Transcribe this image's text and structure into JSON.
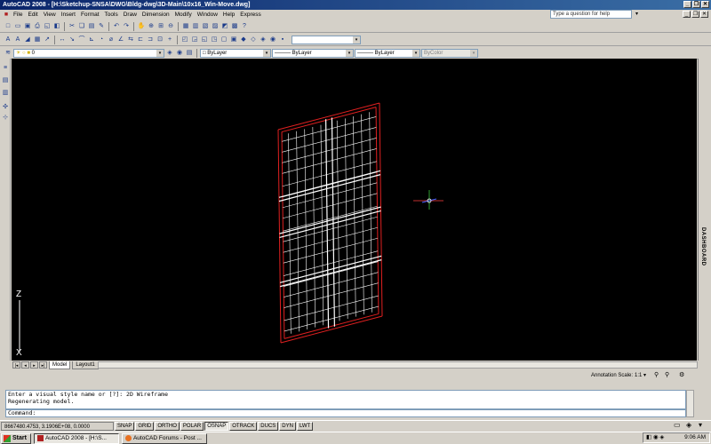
{
  "window": {
    "title": "AutoCAD 2008 - [H:\\Sketchup-SNSA\\DWG\\Bldg-dwg\\3D-Main\\10x16_Win-Move.dwg]",
    "buttons": [
      "_",
      "❐",
      "✕"
    ]
  },
  "menu": [
    "File",
    "Edit",
    "View",
    "Insert",
    "Format",
    "Tools",
    "Draw",
    "Dimension",
    "Modify",
    "Window",
    "Help",
    "Express"
  ],
  "help_search": {
    "placeholder": "Type a question for help"
  },
  "layers": {
    "current_layer": "0",
    "color": "ByLayer",
    "linetype": "ByLayer",
    "lineweight": "ByLayer",
    "plotstyle": "ByColor"
  },
  "tabs": [
    "Model",
    "Layout1"
  ],
  "active_tab": "Model",
  "annotation": {
    "label": "Annotation Scale:",
    "value": "1:1 ▾"
  },
  "dashboard_label": "DASHBOARD",
  "ucs": {
    "z_label": "Z",
    "x_label": "X"
  },
  "command_history": [
    "Enter a visual style name or [?]: 2D Wireframe",
    "Regenerating model."
  ],
  "command_prompt": "Command:",
  "status": {
    "coords": "8667480.4753, 3.1906E+08, 0.0000",
    "toggles": [
      {
        "label": "SNAP",
        "on": false
      },
      {
        "label": "GRID",
        "on": false
      },
      {
        "label": "ORTHO",
        "on": false
      },
      {
        "label": "POLAR",
        "on": false
      },
      {
        "label": "OSNAP",
        "on": true
      },
      {
        "label": "OTRACK",
        "on": false
      },
      {
        "label": "DUCS",
        "on": false
      },
      {
        "label": "DYN",
        "on": false
      },
      {
        "label": "LWT",
        "on": false
      }
    ]
  },
  "taskbar": {
    "start": "Start",
    "tasks": [
      {
        "label": "AutoCAD 2008 - [H:\\S...",
        "active": true
      },
      {
        "label": "AutoCAD Forums - Post ...",
        "active": false
      }
    ],
    "clock": "9:06 AM"
  },
  "colors": {
    "frame": "#e02020",
    "mullion": "#ffffff",
    "canvas": "#000000"
  }
}
